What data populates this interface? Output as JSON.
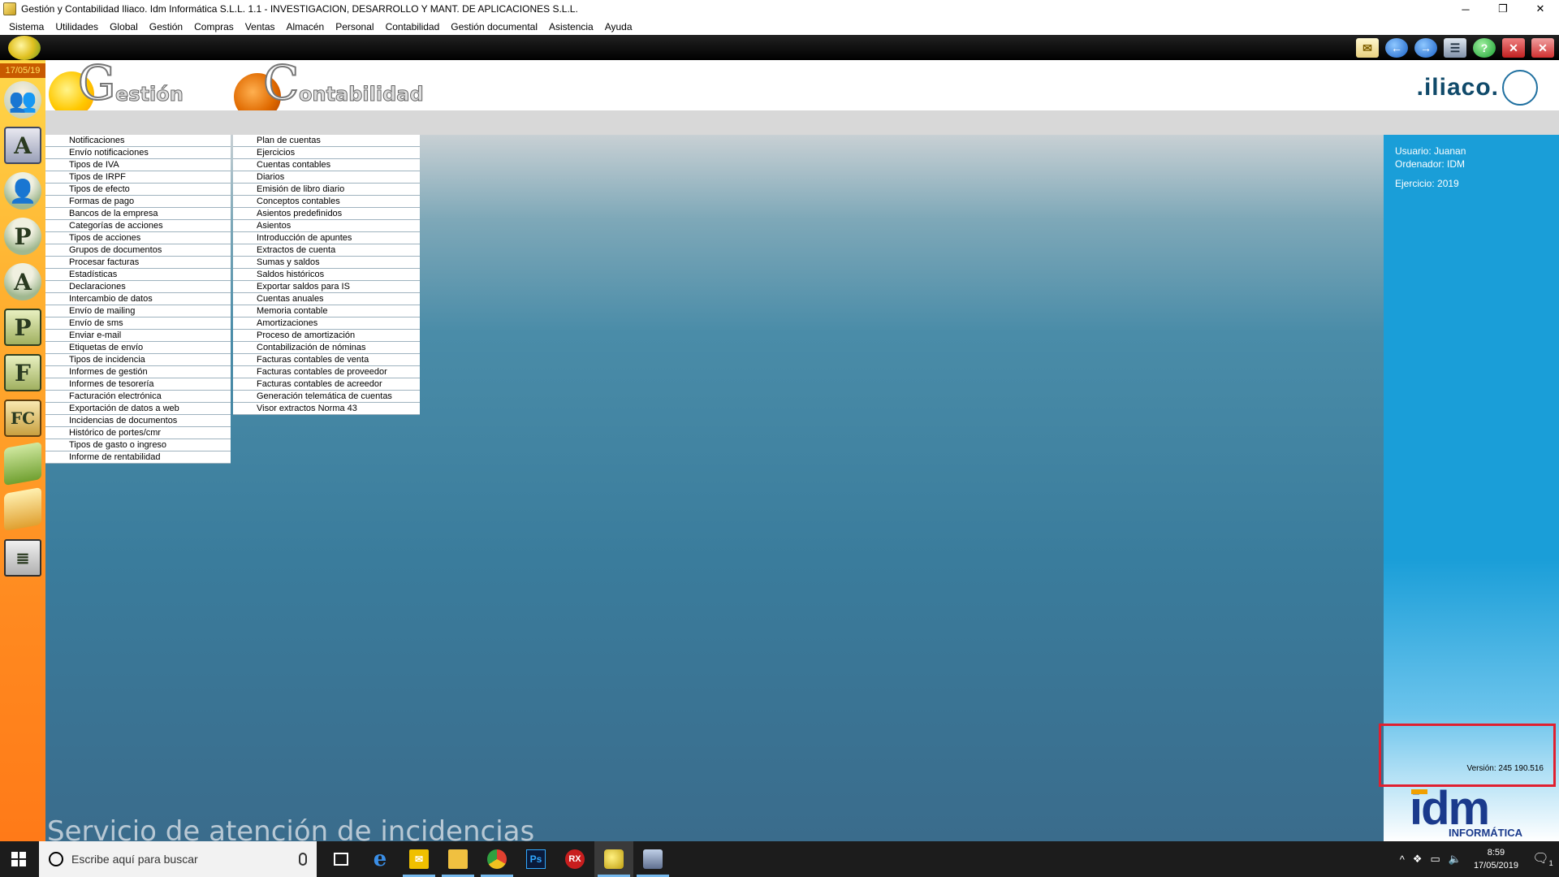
{
  "window": {
    "title": "Gestión y Contabilidad Iliaco. Idm Informática S.L.L. 1.1 - INVESTIGACION, DESARROLLO Y MANT. DE APLICACIONES S.L.L.",
    "controls": {
      "minimize": "─",
      "restore": "❐",
      "close": "✕"
    }
  },
  "menubar": [
    "Sistema",
    "Utilidades",
    "Global",
    "Gestión",
    "Compras",
    "Ventas",
    "Almacén",
    "Personal",
    "Contabilidad",
    "Gestión documental",
    "Asistencia",
    "Ayuda"
  ],
  "toolbar": {
    "icons": [
      {
        "name": "mail-icon",
        "glyph": "✉"
      },
      {
        "name": "back-arrow-icon",
        "glyph": "←"
      },
      {
        "name": "forward-arrow-icon",
        "glyph": "→"
      },
      {
        "name": "list-icon",
        "glyph": "☰"
      },
      {
        "name": "help-icon",
        "glyph": "?"
      },
      {
        "name": "close-window-icon",
        "glyph": "✕"
      },
      {
        "name": "exit-icon",
        "glyph": "✕"
      }
    ]
  },
  "sidebar": {
    "date": "17/05/19",
    "icons": [
      {
        "name": "users-group-icon",
        "glyph": "👥",
        "cls": "si-people"
      },
      {
        "name": "agenda-a-icon",
        "glyph": "A",
        "cls": "si-a"
      },
      {
        "name": "client-icon",
        "glyph": "👤",
        "cls": "si-user"
      },
      {
        "name": "provider-icon",
        "glyph": "P",
        "cls": "si-user"
      },
      {
        "name": "agent-icon",
        "glyph": "A",
        "cls": "si-user"
      },
      {
        "name": "p-document-icon",
        "glyph": "P",
        "cls": "si-p"
      },
      {
        "name": "f-document-icon",
        "glyph": "F",
        "cls": "si-f"
      },
      {
        "name": "fc-document-icon",
        "glyph": "FC",
        "cls": "si-fc"
      },
      {
        "name": "shopping-bag-green-icon",
        "glyph": "",
        "cls": "si-bag1"
      },
      {
        "name": "shopping-bag-yellow-icon",
        "glyph": "",
        "cls": "si-bag2"
      },
      {
        "name": "ledger-book-icon",
        "glyph": "≣",
        "cls": "si-book"
      }
    ]
  },
  "header": {
    "gestion_initial": "G",
    "gestion_rest": "estión",
    "contab_initial": "C",
    "contab_rest": "ontabilidad",
    "brand": ".iliaco."
  },
  "gestion_menu": [
    "Notificaciones",
    "Envío notificaciones",
    "Tipos de IVA",
    "Tipos de IRPF",
    "Tipos de efecto",
    "Formas de pago",
    "Bancos de la empresa",
    "Categorías de acciones",
    "Tipos de acciones",
    "Grupos de documentos",
    "Procesar facturas",
    "Estadísticas",
    "Declaraciones",
    "Intercambio de datos",
    "Envío de mailing",
    "Envío de sms",
    "Enviar e-mail",
    "Etiquetas de envío",
    "Tipos de incidencia",
    "Informes de gestión",
    "Informes de tesorería",
    "Facturación electrónica",
    "Exportación de datos a web",
    "Incidencias de documentos",
    "Histórico de portes/cmr",
    "Tipos de gasto o ingreso",
    "Informe de rentabilidad"
  ],
  "contabilidad_menu": [
    "Plan de cuentas",
    "Ejercicios",
    "Cuentas contables",
    "Diarios",
    "Emisión de libro diario",
    "Conceptos contables",
    "Asientos predefinidos",
    "Asientos",
    "Introducción de apuntes",
    "Extractos de cuenta",
    "Sumas y saldos",
    "Saldos históricos",
    "Exportar saldos para IS",
    "Cuentas anuales",
    "Memoria contable",
    "Amortizaciones",
    "Proceso de amortización",
    "Contabilización de nóminas",
    "Facturas contables de venta",
    "Facturas contables de proveedor",
    "Facturas contables de acreedor",
    "Generación telemática de cuentas",
    "Visor extractos Norma 43"
  ],
  "service_text": "Servicio de atención de incidencias",
  "info_panel": {
    "usuario": "Usuario: Juanan",
    "ordenador": "Ordenador: IDM",
    "ejercicio": "Ejercicio: 2019",
    "version": "Versión: 245 190.516"
  },
  "idm_logo": {
    "letters": "idm",
    "sub": "INFORMÁTICA"
  },
  "taskbar": {
    "search_placeholder": "Escribe aquí para buscar",
    "apps": [
      {
        "name": "task-view-icon",
        "glyph": "",
        "cls": "g-taskview",
        "state": ""
      },
      {
        "name": "edge-icon",
        "glyph": "e",
        "cls": "g-edge",
        "state": ""
      },
      {
        "name": "mail-app-icon",
        "glyph": "✉",
        "cls": "g-mail",
        "state": "active"
      },
      {
        "name": "file-explorer-icon",
        "glyph": "",
        "cls": "g-folder",
        "state": "active"
      },
      {
        "name": "chrome-icon",
        "glyph": "",
        "cls": "g-chrome",
        "state": "active"
      },
      {
        "name": "photoshop-icon",
        "glyph": "Ps",
        "cls": "g-ps",
        "state": ""
      },
      {
        "name": "rx-app-icon",
        "glyph": "RX",
        "cls": "g-rx",
        "state": ""
      },
      {
        "name": "gestion-contabilidad-app-icon",
        "glyph": "",
        "cls": "g-gc",
        "state": "active current"
      },
      {
        "name": "scanner-app-icon",
        "glyph": "",
        "cls": "g-scan",
        "state": "active"
      }
    ],
    "time": "8:59",
    "date": "17/05/2019",
    "notification_badge": "1"
  }
}
